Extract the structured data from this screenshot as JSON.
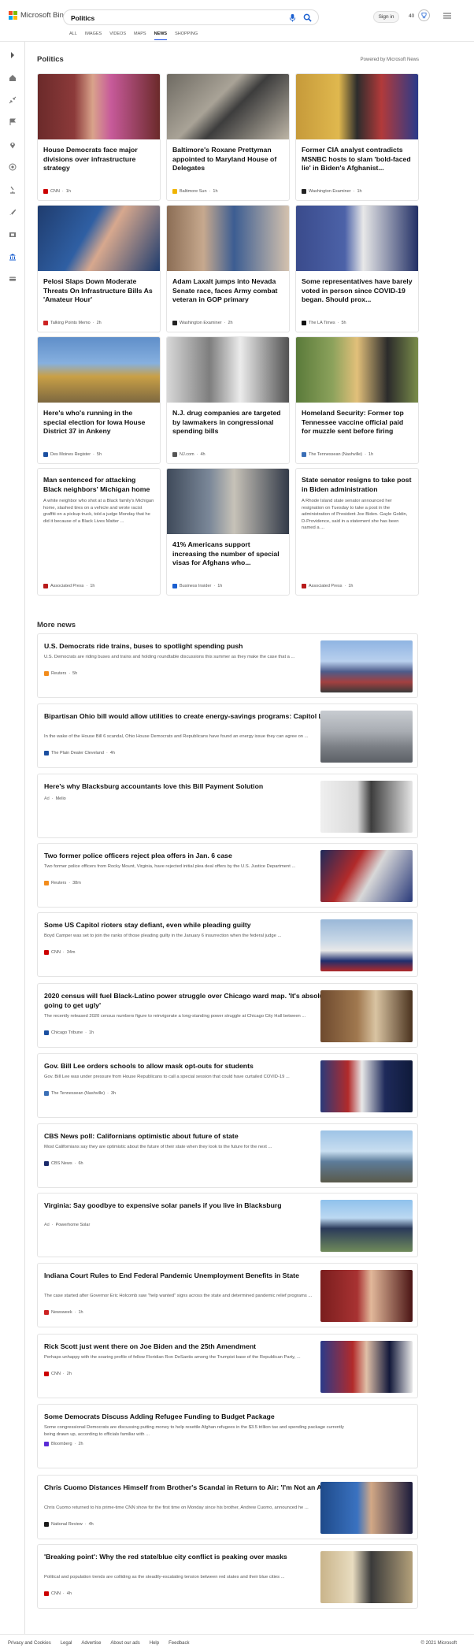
{
  "header": {
    "logo_text": "Microsoft Bing",
    "search_value": "Politics",
    "signin": "Sign in",
    "points": "40",
    "nav": [
      "ALL",
      "IMAGES",
      "VIDEOS",
      "MAPS",
      "NEWS",
      "SHOPPING"
    ],
    "active_nav": "NEWS"
  },
  "colors": {
    "accent": "#174ae4",
    "bing_blue": "#1a5fd0"
  },
  "sidebar_icons": [
    "chevron-right-icon",
    "home-icon",
    "shrink-icon",
    "flag-icon",
    "location-pin-icon",
    "globe-icon",
    "microscope-icon",
    "rocket-icon",
    "film-icon",
    "bank-icon",
    "card-icon"
  ],
  "section": {
    "title": "Politics",
    "powered_by": "Powered by Microsoft News"
  },
  "cards": [
    {
      "title": "House Democrats face major divisions over infrastructure strategy",
      "source": "CNN",
      "time": "1h",
      "snippet": "",
      "fav": "#cc0000",
      "img": "pelosi"
    },
    {
      "title": "Baltimore's Roxane Prettyman appointed to Maryland House of Delegates",
      "source": "Baltimore Sun",
      "time": "1h",
      "snippet": "",
      "fav": "#f0b400",
      "img": "kitchen"
    },
    {
      "title": "Former CIA analyst contradicts MSNBC hosts to slam 'bold-faced lie' in Biden's Afghanist...",
      "source": "Washington Examiner",
      "time": "1h",
      "snippet": "",
      "fav": "#222222",
      "img": "podium"
    },
    {
      "title": "Pelosi Slaps Down Moderate Threats On Infrastructure Bills As 'Amateur Hour'",
      "source": "Talking Points Memo",
      "time": "2h",
      "snippet": "",
      "fav": "#cc2222",
      "img": "pelosi2"
    },
    {
      "title": "Adam Laxalt jumps into Nevada Senate race, faces Army combat veteran in GOP primary",
      "source": "Washington Examiner",
      "time": "2h",
      "snippet": "",
      "fav": "#222222",
      "img": "crowd"
    },
    {
      "title": "Some representatives have barely voted in person since COVID-19 began. Should prox...",
      "source": "The LA Times",
      "time": "5h",
      "snippet": "",
      "fav": "#111111",
      "img": "mask"
    },
    {
      "title": "Here's who's running in the special election for Iowa House District 37 in Ankeny",
      "source": "Des Moines Register",
      "time": "5h",
      "snippet": "",
      "fav": "#1b4fa0",
      "img": "capitol"
    },
    {
      "title": "N.J. drug companies are targeted by lawmakers in congressional spending bills",
      "source": "NJ.com",
      "time": "4h",
      "snippet": "",
      "fav": "#555555",
      "img": "meeting"
    },
    {
      "title": "Homeland Security: Former top Tennessee vaccine official paid for muzzle sent before firing",
      "source": "The Tennessean (Nashville)",
      "time": "1h",
      "snippet": "",
      "fav": "#3b6fb6",
      "img": "woman"
    },
    {
      "title": "Man sentenced for attacking Black neighbors' Michigan home",
      "source": "Associated Press",
      "time": "1h",
      "snippet": "A white neighbor who shot at a Black family's Michigan home, slashed tires on a vehicle and wrote racist graffiti on a pickup truck, told a judge Monday that he did it because of a Black Lives Matter ...",
      "fav": "#b81b1b",
      "img": ""
    },
    {
      "title": "41% Americans support increasing the number of special visas for Afghans who...",
      "source": "Business Insider",
      "time": "1h",
      "snippet": "",
      "fav": "#1a5fd0",
      "img": "airport"
    },
    {
      "title": "State senator resigns to take post in Biden administration",
      "source": "Associated Press",
      "time": "1h",
      "snippet": "A Rhode Island state senator announced her resignation on Tuesday to take a post in the administration of President Joe Biden. Gayle Goldin, D-Providence, said in a statement she has been named a ...",
      "fav": "#b81b1b",
      "img": ""
    }
  ],
  "more_news": {
    "title": "More news",
    "items": [
      {
        "title": "U.S. Democrats ride trains, buses to spotlight spending push",
        "snippet": "U.S. Democrats are riding buses and trains and holding roundtable discussions this summer as they make the case that a ...",
        "source": "Reuters",
        "time": "5h",
        "ad": false,
        "fav": "#f28c1c",
        "img": "train"
      },
      {
        "title": "Bipartisan Ohio bill would allow utilities to create energy-savings programs: Capitol Letter",
        "snippet": "In the wake of the House Bill 6 scandal, Ohio House Democrats and Republicans have found an energy issue they can agree on ...",
        "source": "The Plain Dealer Cleveland",
        "time": "4h",
        "ad": false,
        "fav": "#1b4fa0",
        "img": "building"
      },
      {
        "title": "Here's why Blacksburg accountants love this Bill Payment Solution",
        "snippet": "",
        "source": "Melio",
        "time": "",
        "ad": true,
        "fav": "",
        "img": "office"
      },
      {
        "title": "Two former police officers reject plea offers in Jan. 6 case",
        "snippet": "Two former police officers from Rocky Mount, Virginia, have rejected initial plea deal offers by the U.S. Justice Department ...",
        "source": "Reuters",
        "time": "38m",
        "ad": false,
        "fav": "#f28c1c",
        "img": "riot"
      },
      {
        "title": "Some US Capitol rioters stay defiant, even while pleading guilty",
        "snippet": "Boyd Camper was set to join the ranks of those pleading guilty in the January 6 insurrection when the federal judge ...",
        "source": "CNN",
        "time": "34m",
        "ad": false,
        "fav": "#cc0000",
        "img": "uscapitol"
      },
      {
        "title": "2020 census will fuel Black-Latino power struggle over Chicago ward map. 'It's absolutely going to get ugly'",
        "snippet": "The recently released 2020 census numbers figure to reinvigorate a long-standing power struggle at Chicago City Hall between ...",
        "source": "Chicago Tribune",
        "time": "1h",
        "ad": false,
        "fav": "#1b4fa0",
        "img": "council"
      },
      {
        "title": "Gov. Bill Lee orders schools to allow mask opt-outs for students",
        "snippet": "Gov. Bill Lee was under pressure from House Republicans to call a special session that could have curtailed COVID-19 ...",
        "source": "The Tennessean (Nashville)",
        "time": "3h",
        "ad": false,
        "fav": "#3b6fb6",
        "img": "gov"
      },
      {
        "title": "CBS News poll: Californians optimistic about future of state",
        "snippet": "Most Californians say they are optimistic about the future of their state when they look to the future for the next ...",
        "source": "CBS News",
        "time": "6h",
        "ad": false,
        "fav": "#1a2a6a",
        "img": "beach"
      },
      {
        "title": "Virginia: Say goodbye to expensive solar panels if you live in Blacksburg",
        "snippet": "",
        "source": "Powerhome Solar",
        "time": "",
        "ad": true,
        "fav": "",
        "img": "solar"
      },
      {
        "title": "Indiana Court Rules to End Federal Pandemic Unemployment Benefits in State",
        "snippet": "The case started after Governor Eric Holcomb saw \"help wanted\" signs across the state and determined pandemic relief programs ...",
        "source": "Newsweek",
        "time": "1h",
        "ad": false,
        "fav": "#cc2222",
        "img": "holcomb"
      },
      {
        "title": "Rick Scott just went there on Joe Biden and the 25th Amendment",
        "snippet": "Perhaps unhappy with the soaring profile of fellow Floridian Ron DeSantis among the Trumpist base of the Republican Party, ...",
        "source": "CNN",
        "time": "2h",
        "ad": false,
        "fav": "#cc0000",
        "img": "scott"
      },
      {
        "title": "Some Democrats Discuss Adding Refugee Funding to Budget Package",
        "snippet": "Some congressional Democrats are discussing putting money to help resettle Afghan refugees in the $3.5 trillion tax and spending package currently being drawn up, according to officials familiar with ...",
        "source": "Bloomberg",
        "time": "2h",
        "ad": false,
        "fav": "#5a2bd6",
        "img": ""
      },
      {
        "title": "Chris Cuomo Distances Himself from Brother's Scandal in Return to Air: 'I'm Not an Adviser'",
        "snippet": "Chris Cuomo returned to his prime-time CNN show for the first time on Monday since his brother, Andrew Cuomo, announced he ...",
        "source": "National Review",
        "time": "4h",
        "ad": false,
        "fav": "#1a1a1a",
        "img": "cuomo"
      },
      {
        "title": "'Breaking point': Why the red state/blue city conflict is peaking over masks",
        "snippet": "Political and population trends are colliding as the steadily-escalating tension between red states and their blue cities ...",
        "source": "CNN",
        "time": "4h",
        "ad": false,
        "fav": "#cc0000",
        "img": "protest"
      }
    ],
    "ad_label": "Ad"
  },
  "footer": {
    "links": [
      "Privacy and Cookies",
      "Legal",
      "Advertise",
      "About our ads",
      "Help",
      "Feedback"
    ],
    "copyright": "© 2021 Microsoft"
  }
}
